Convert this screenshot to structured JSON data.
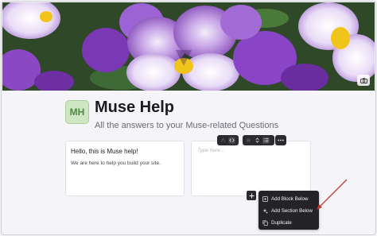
{
  "cover": {
    "camera_icon": "camera-icon"
  },
  "site": {
    "avatar_initials": "MH",
    "title": "Muse Help",
    "subtitle": "All the answers to your Muse-related Questions"
  },
  "blocks": [
    {
      "heading": "Hello, this is Muse help!",
      "body": "We are here to help you build your site."
    },
    {
      "placeholder": "Type here..."
    }
  ],
  "toolbar": {
    "icons": [
      "text-size-icon",
      "code-icon",
      "align-icon",
      "sort-icon",
      "list-icon",
      "more-icon"
    ]
  },
  "context_menu": {
    "items": [
      {
        "label": "Add Block Below",
        "icon": "block-add-icon"
      },
      {
        "label": "Add Section Below",
        "icon": "section-add-icon"
      },
      {
        "label": "Duplicate",
        "icon": "duplicate-icon"
      }
    ]
  },
  "colors": {
    "avatar_bg": "#cfe6c4",
    "avatar_text": "#4f8a3e",
    "menu_bg": "#242428",
    "annotation_arrow": "#c0392b"
  }
}
